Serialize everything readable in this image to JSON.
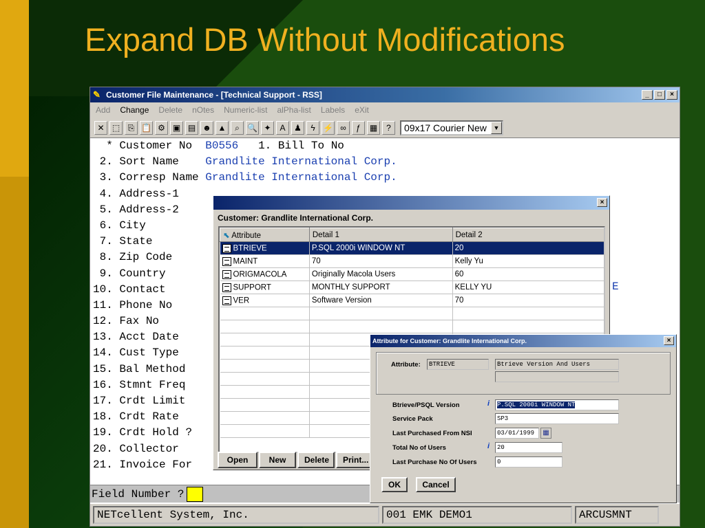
{
  "slide": {
    "title": "Expand DB Without Modifications"
  },
  "window": {
    "title": "Customer File Maintenance - [Technical Support - RSS]",
    "minimize": "_",
    "maximize": "□",
    "close": "×",
    "menu": [
      "Add",
      "Change",
      "Delete",
      "nOtes",
      "Numeric-list",
      "alPha-list",
      "Labels",
      "eXit"
    ],
    "font_select": "09x17 Courier New"
  },
  "terminal": {
    "rows": [
      {
        "num": "  *",
        "label": "Customer No ",
        "value": "B0556",
        "extra": "   1. Bill To No"
      },
      {
        "num": " 2.",
        "label": "Sort Name   ",
        "value": "Grandlite International Corp.",
        "extra": ""
      },
      {
        "num": " 3.",
        "label": "Corresp Name",
        "value": "Grandlite International Corp.",
        "extra": ""
      },
      {
        "num": " 4.",
        "label": "Address-1",
        "value": "",
        "extra": ""
      },
      {
        "num": " 5.",
        "label": "Address-2",
        "value": "",
        "extra": ""
      },
      {
        "num": " 6.",
        "label": "City",
        "value": "",
        "extra": ""
      },
      {
        "num": " 7.",
        "label": "State",
        "value": "",
        "extra": ""
      },
      {
        "num": " 8.",
        "label": "Zip Code",
        "value": "",
        "extra": ""
      },
      {
        "num": " 9.",
        "label": "Country",
        "value": "",
        "extra": ""
      },
      {
        "num": "10.",
        "label": "Contact",
        "value": "",
        "extra": ""
      },
      {
        "num": "11.",
        "label": "Phone No",
        "value": "",
        "extra": ""
      },
      {
        "num": "12.",
        "label": "Fax No",
        "value": "",
        "extra": ""
      },
      {
        "num": "13.",
        "label": "Acct Date",
        "value": "",
        "extra": ""
      },
      {
        "num": "14.",
        "label": "Cust Type",
        "value": "",
        "extra": ""
      },
      {
        "num": "15.",
        "label": "Bal Method",
        "value": "",
        "extra": ""
      },
      {
        "num": "16.",
        "label": "Stmnt Freq",
        "value": "",
        "extra": ""
      },
      {
        "num": "17.",
        "label": "Crdt Limit",
        "value": "",
        "extra": ""
      },
      {
        "num": "18.",
        "label": "Crdt Rate",
        "value": "",
        "extra": ""
      },
      {
        "num": "19.",
        "label": "Crdt Hold ?",
        "value": "",
        "extra": ""
      },
      {
        "num": "20.",
        "label": "Collector",
        "value": "",
        "extra": ""
      },
      {
        "num": "21.",
        "label": "Invoice For",
        "value": "",
        "extra": ""
      }
    ],
    "partial_right": "E",
    "field_prompt": "Field Number ?",
    "status": [
      "NETcellent System, Inc.",
      "001 EMK      DEMO1",
      "ARCUSMNT"
    ]
  },
  "attr_dialog": {
    "close": "×",
    "caption": "Customer: Grandlite International Corp.",
    "columns": [
      "Attribute",
      "Detail 1",
      "Detail 2"
    ],
    "rows": [
      {
        "attr": "BTRIEVE",
        "d1": "P.SQL 2000i WINDOW NT",
        "d2": "20"
      },
      {
        "attr": "MAINT",
        "d1": "70",
        "d2": "Kelly Yu"
      },
      {
        "attr": "ORIGMACOLA",
        "d1": "Originally Macola Users",
        "d2": "60"
      },
      {
        "attr": "SUPPORT",
        "d1": "MONTHLY SUPPORT",
        "d2": "KELLY YU"
      },
      {
        "attr": "VER",
        "d1": "Software Version",
        "d2": "70"
      }
    ],
    "buttons": [
      "Open",
      "New",
      "Delete",
      "Print..."
    ]
  },
  "detail_dialog": {
    "title": "Attribute for Customer: Grandlite International Corp.",
    "close": "×",
    "attribute_label": "Attribute:",
    "attribute_value": "BTRIEVE",
    "attribute_desc": "Btrieve Version And Users",
    "fields": [
      {
        "label": "Btrieve/PSQL Version",
        "value": "P.SQL 2000i WINDOW NT"
      },
      {
        "label": "Service Pack",
        "value": "SP3"
      },
      {
        "label": "Last Purchased From NSI",
        "value": "03/01/1999"
      },
      {
        "label": "Total No of Users",
        "value": "20"
      },
      {
        "label": "Last Purchase No Of Users",
        "value": "0"
      }
    ],
    "info_glyph": "i",
    "ok": "OK",
    "cancel": "Cancel"
  }
}
